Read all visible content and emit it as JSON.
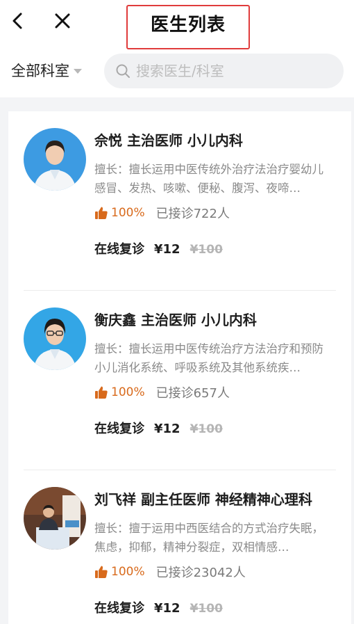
{
  "header": {
    "title": "医生列表",
    "back_icon": "chevron-left-icon",
    "close_icon": "close-icon"
  },
  "filter": {
    "department_label": "全部科室",
    "search_placeholder": "搜索医生/科室"
  },
  "colors": {
    "accent_orange": "#d86a1c",
    "highlight_red": "#e03b3b"
  },
  "doctors": [
    {
      "name_line": "佘悦 主治医师 小儿内科",
      "specialty": "擅长：擅长运用中医传统外治疗法治疗婴幼儿感冒、发热、咳嗽、便秘、腹泻、夜啼…",
      "rating": "100%",
      "served": "已接诊722人",
      "consult_label": "在线复诊",
      "price": "¥12",
      "original_price": "¥100"
    },
    {
      "name_line": "衡庆鑫 主治医师 小儿内科",
      "specialty": "擅长：擅长运用中医传统治疗方法治疗和预防小儿消化系统、呼吸系统及其他系统疾…",
      "rating": "100%",
      "served": "已接诊657人",
      "consult_label": "在线复诊",
      "price": "¥12",
      "original_price": "¥100"
    },
    {
      "name_line": "刘飞祥 副主任医师 神经精神心理科",
      "specialty": "擅长：擅于运用中西医结合的方式治疗失眠，焦虑，抑郁，精神分裂症，双相情感…",
      "rating": "100%",
      "served": "已接诊23042人",
      "consult_label": "在线复诊",
      "price": "¥12",
      "original_price": "¥100"
    }
  ]
}
